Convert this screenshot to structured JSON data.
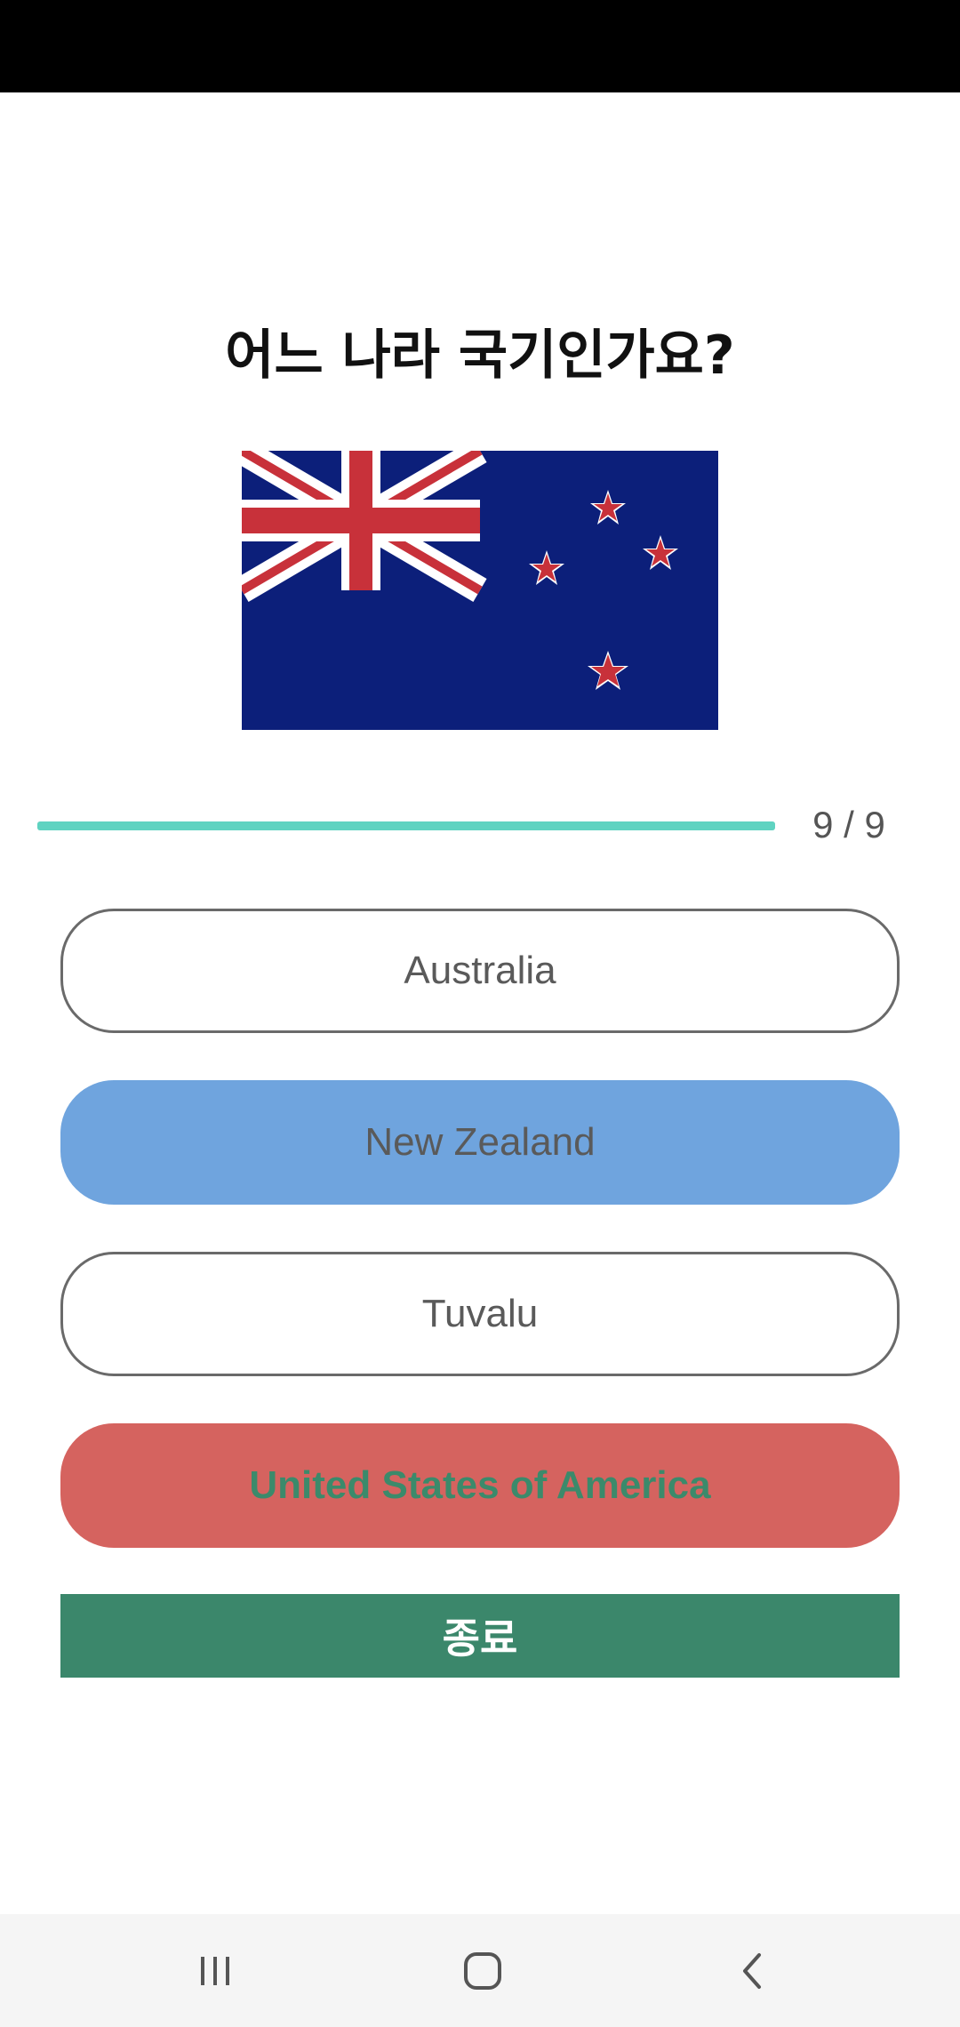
{
  "quiz": {
    "question": "어느 나라 국기인가요?",
    "flag_icon": "new-zealand-flag",
    "progress": {
      "current": 9,
      "total": 9,
      "label": "9 / 9",
      "fraction": 1.0
    },
    "options": [
      {
        "label": "Australia",
        "state": "default"
      },
      {
        "label": "New Zealand",
        "state": "selected"
      },
      {
        "label": "Tuvalu",
        "state": "default"
      },
      {
        "label": "United States of America",
        "state": "wrong"
      }
    ],
    "end_button_label": "종료"
  },
  "colors": {
    "progress": "#5fd3c1",
    "selected": "#6fa4de",
    "wrong": "#d5635f",
    "end_button": "#3b876b"
  },
  "navigation": {
    "icons": [
      "recent-apps-icon",
      "home-icon",
      "back-icon"
    ]
  }
}
